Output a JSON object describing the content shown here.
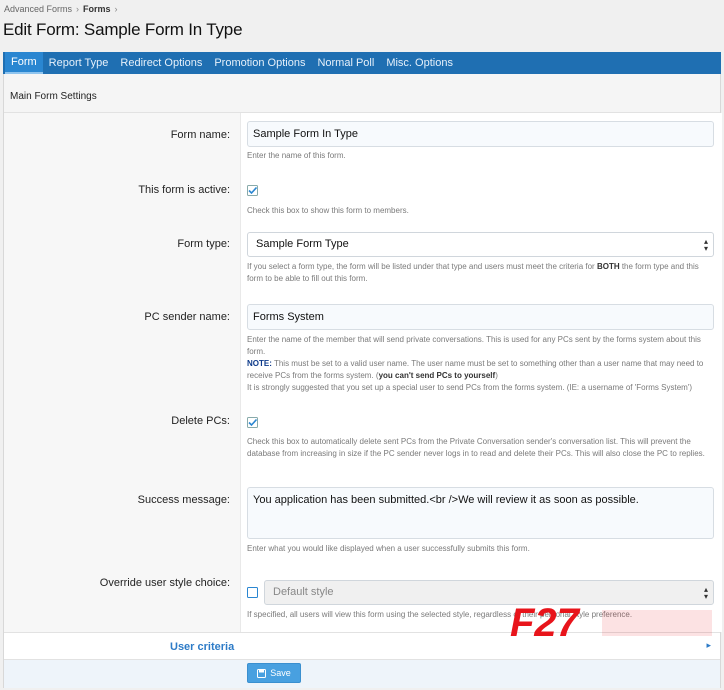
{
  "breadcrumb": {
    "items": [
      "Advanced Forms",
      "Forms"
    ],
    "sep": "›"
  },
  "page": {
    "title": "Edit Form: Sample Form In Type"
  },
  "tabs": [
    {
      "label": "Form",
      "active": true
    },
    {
      "label": "Report Type",
      "active": false
    },
    {
      "label": "Redirect Options",
      "active": false
    },
    {
      "label": "Promotion Options",
      "active": false
    },
    {
      "label": "Normal Poll",
      "active": false
    },
    {
      "label": "Misc. Options",
      "active": false
    }
  ],
  "section": {
    "title": "Main Form Settings"
  },
  "fields": {
    "form_name": {
      "label": "Form name:",
      "value": "Sample Form In Type",
      "hint": "Enter the name of this form."
    },
    "active": {
      "label": "This form is active:",
      "checked": true,
      "hint": "Check this box to show this form to members."
    },
    "form_type": {
      "label": "Form type:",
      "selected": "Sample Form Type",
      "hint_pre": "If you select a form type, the form will be listed under that type and users must meet the criteria for ",
      "hint_bold": "BOTH",
      "hint_post": " the form type and this form to be able to fill out this form."
    },
    "pc_sender": {
      "label": "PC sender name:",
      "value": "Forms System",
      "hint1": "Enter the name of the member that will send private conversations. This is used for any PCs sent by the forms system about this form.",
      "note_label": "NOTE:",
      "hint2": " This must be set to a valid user name. The user name must be set to something other than a user name that may need to receive PCs from the forms system. (",
      "hint2_bold": "you can't send PCs to yourself",
      "hint2_end": ")",
      "hint3": "It is strongly suggested that you set up a special user to send PCs from the forms system. (IE: a username of 'Forms System')"
    },
    "delete_pcs": {
      "label": "Delete PCs:",
      "checked": true,
      "hint": "Check this box to automatically delete sent PCs from the Private Conversation sender's conversation list. This will prevent the database from increasing in size if the PC sender never logs in to read and delete their PCs. This will also close the PC to replies."
    },
    "success_message": {
      "label": "Success message:",
      "value": "You application has been submitted.<br />We will review it as soon as possible.",
      "hint": "Enter what you would like displayed when a user successfully submits this form."
    },
    "override_style": {
      "label": "Override user style choice:",
      "checked": false,
      "selected": "Default style",
      "hint": "If specified, all users will view this form using the selected style, regardless of their personal style preference."
    }
  },
  "user_criteria": {
    "label": "User criteria"
  },
  "actions": {
    "save_label": "Save"
  },
  "watermark": {
    "text": "F27"
  },
  "colors": {
    "tab_bar": "#1f6fb2",
    "tab_active": "#2a86d1",
    "accent": "#2d7bc7",
    "save": "#48a0e0",
    "watermark": "#e8141b"
  }
}
